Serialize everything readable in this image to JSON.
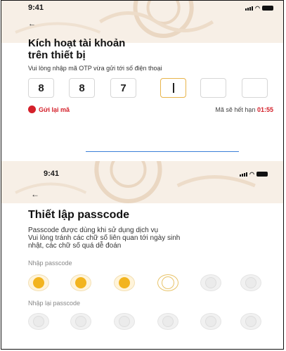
{
  "screen1": {
    "status_time": "9:41",
    "back_glyph": "←",
    "title_line1": "Kích hoạt tài khoản",
    "title_line2": "trên thiết bị",
    "subtitle": "Vui lòng nhập mã OTP vừa gửi tới số điện thoại",
    "otp_digits": [
      "8",
      "8",
      "7",
      "",
      "",
      ""
    ],
    "resend_label": "Gửi lại mã",
    "resend_icon": "refresh-icon",
    "expire_prefix": "Mã sẽ hết hạn",
    "expire_time": "01:55"
  },
  "screen2": {
    "status_time": "9:41",
    "back_glyph": "←",
    "title": "Thiết lập passcode",
    "desc_line1": "Passcode được dùng khi sử dụng dịch vụ",
    "desc_line2": "Vui lòng tránh các chữ số liên quan tới ngày sinh",
    "desc_line3": "nhật, các chữ số quá dễ đoán",
    "passcode_label": "Nhập passcode",
    "passcode_entered": 3,
    "passcode_length": 6,
    "repeat_label": "Nhập lại passcode",
    "repeat_entered": 0
  },
  "colors": {
    "accent_red": "#d4202a",
    "passcode_gold": "#f2b41f",
    "divider_blue": "#3b7fd8"
  }
}
